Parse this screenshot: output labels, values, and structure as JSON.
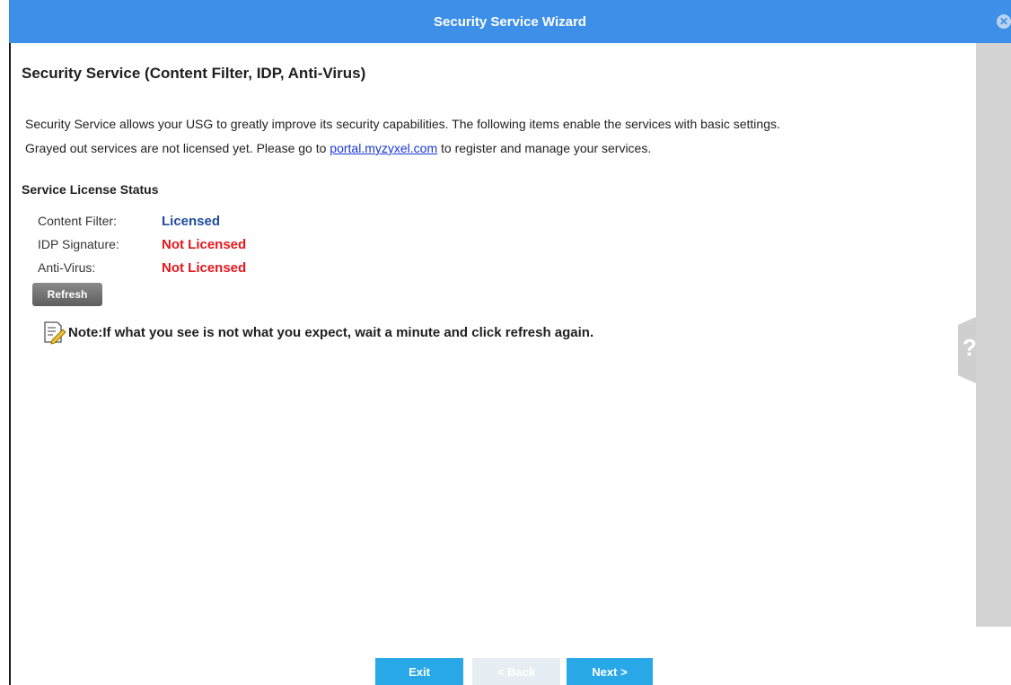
{
  "window": {
    "title": "Security Service Wizard",
    "close_glyph": "✕"
  },
  "page": {
    "title": "Security Service (Content Filter, IDP, Anti-Virus)",
    "intro": "Security Service allows your USG to greatly improve its security capabilities. The following items enable the services with basic settings.",
    "license_prefix": "Grayed out services are not licensed yet. Please go to",
    "license_link": "portal.myzyxel.com",
    "license_suffix": "to register and manage your services."
  },
  "license_status": {
    "heading": "Service License Status",
    "items": [
      {
        "label": "Content Filter:",
        "status": "Licensed",
        "status_color": "#1f4b9e"
      },
      {
        "label": "IDP Signature:",
        "status": "Not Licensed",
        "status_color": "#e5171d"
      },
      {
        "label": "Anti-Virus:",
        "status": "Not Licensed",
        "status_color": "#e5171d"
      }
    ],
    "refresh_label": "Refresh"
  },
  "note": {
    "icon": "note-edit-icon",
    "text": "Note:If what you see is not what you expect, wait a minute and click refresh again."
  },
  "help": {
    "glyph": "?",
    "icon": "help-icon"
  },
  "footer": {
    "exit_label": "Exit",
    "back_label": "< Back",
    "next_label": "Next >"
  },
  "colors": {
    "titlebar": "#3d8fe8",
    "button_primary": "#29a8e8",
    "button_disabled": "#e7eef3",
    "licensed": "#1f4b9e",
    "not_licensed": "#e5171d"
  }
}
